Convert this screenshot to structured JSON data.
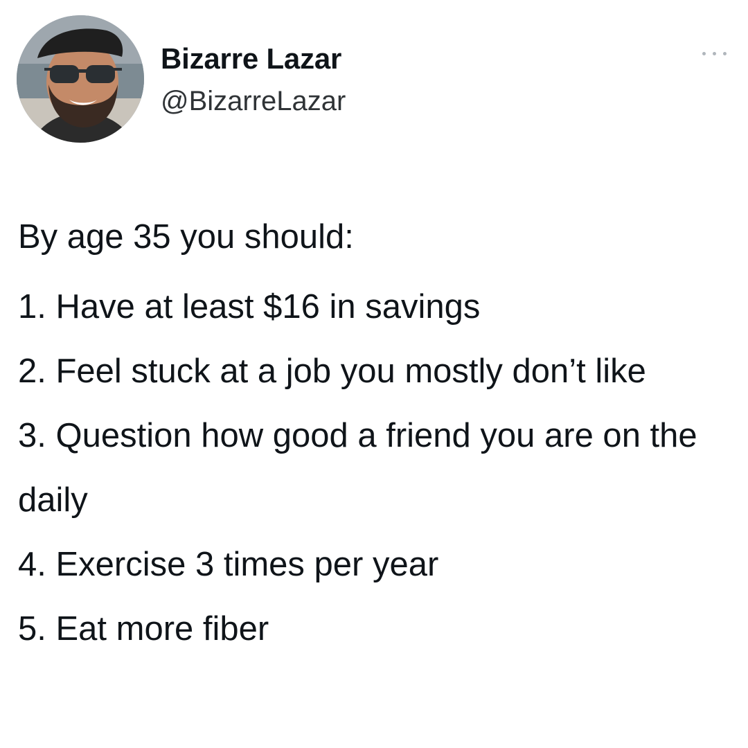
{
  "author": {
    "name": "Bizarre Lazar",
    "handle": "@BizarreLazar",
    "avatar_icon": "profile-photo"
  },
  "more_icon": "ellipsis-icon",
  "tweet": {
    "intro": "By age 35 you should:",
    "items": [
      "1. Have at least $16 in savings",
      "2. Feel stuck at a job you mostly don’t like",
      "3. Question how good a friend you are on the daily",
      "4. Exercise 3 times per year",
      "5. Eat more fiber"
    ]
  },
  "colors": {
    "background": "#ffffff",
    "text": "#0f1419",
    "handle": "#2f3336",
    "more_dots": "#b0b6bc"
  }
}
